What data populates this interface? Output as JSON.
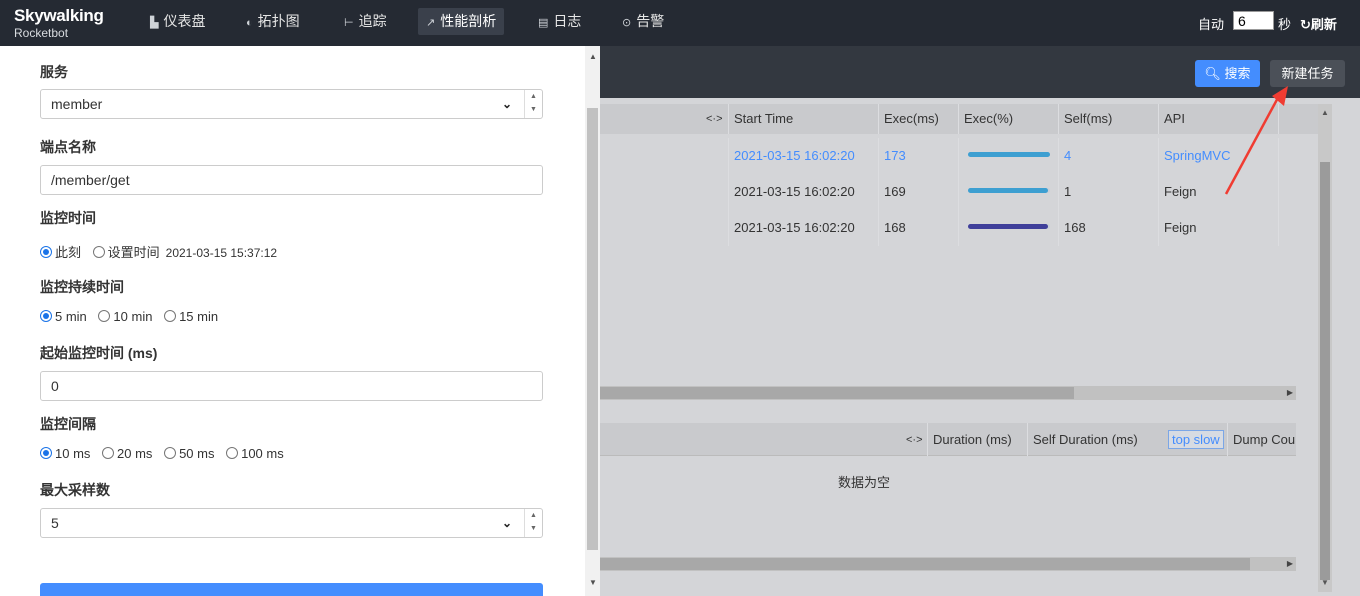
{
  "brand": {
    "name": "Skywalking",
    "sub": "Rocketbot"
  },
  "nav": [
    {
      "icon": "dashboard-icon",
      "glyph": "▙",
      "label": "仪表盘",
      "active": false
    },
    {
      "icon": "topology-icon",
      "glyph": "◐",
      "label": "拓扑图",
      "active": false
    },
    {
      "icon": "trace-icon",
      "glyph": "⊢",
      "label": "追踪",
      "active": false
    },
    {
      "icon": "profile-icon",
      "glyph": "↗",
      "label": "性能剖析",
      "active": true
    },
    {
      "icon": "log-icon",
      "glyph": "▤",
      "label": "日志",
      "active": false
    },
    {
      "icon": "alarm-icon",
      "glyph": "⊙",
      "label": "告警",
      "active": false
    }
  ],
  "header_right": {
    "auto_label": "自动",
    "interval_value": "6",
    "seconds_label": "秒",
    "refresh_label": "刷新"
  },
  "toolbar": {
    "search_label": "搜索",
    "new_task_label": "新建任务"
  },
  "segments": {
    "toggle": "<·>",
    "columns": [
      "Start Time",
      "Exec(ms)",
      "Exec(%)",
      "Self(ms)",
      "API"
    ],
    "rows": [
      {
        "start_time": "2021-03-15 16:02:20",
        "exec_ms": "173",
        "exec_pct": 100,
        "self_ms": "4",
        "api": "SpringMVC",
        "selected": true
      },
      {
        "start_time": "2021-03-15 16:02:20",
        "exec_ms": "169",
        "exec_pct": 98,
        "self_ms": "1",
        "api": "Feign",
        "selected": false
      },
      {
        "start_time": "2021-03-15 16:02:20",
        "exec_ms": "168",
        "exec_pct": 97,
        "self_ms": "168",
        "api": "Feign",
        "selected": false
      }
    ]
  },
  "analysis": {
    "toggle": "<·>",
    "columns": [
      "Duration (ms)",
      "Self Duration (ms)",
      "top slow",
      "Dump Cou"
    ],
    "empty_text": "数据为空"
  },
  "colors": {
    "accent": "#448dfe",
    "bar_normal": "#3d9fd1",
    "bar_slow": "#3f3f9a"
  },
  "form": {
    "service_label": "服务",
    "service_value": "member",
    "endpoint_label": "端点名称",
    "endpoint_value": "/member/get",
    "monitor_time_label": "监控时间",
    "monitor_time_options": [
      "此刻",
      "设置时间"
    ],
    "monitor_time_selected": 0,
    "monitor_time_value": "2021-03-15 15:37:12",
    "duration_label": "监控持续时间",
    "duration_options": [
      "5 min",
      "10 min",
      "15 min"
    ],
    "duration_selected": 0,
    "start_label": "起始监控时间 (ms)",
    "start_value": "0",
    "interval_label": "监控间隔",
    "interval_options": [
      "10 ms",
      "20 ms",
      "50 ms",
      "100 ms"
    ],
    "interval_selected": 0,
    "max_sample_label": "最大采样数",
    "max_sample_value": "5"
  }
}
